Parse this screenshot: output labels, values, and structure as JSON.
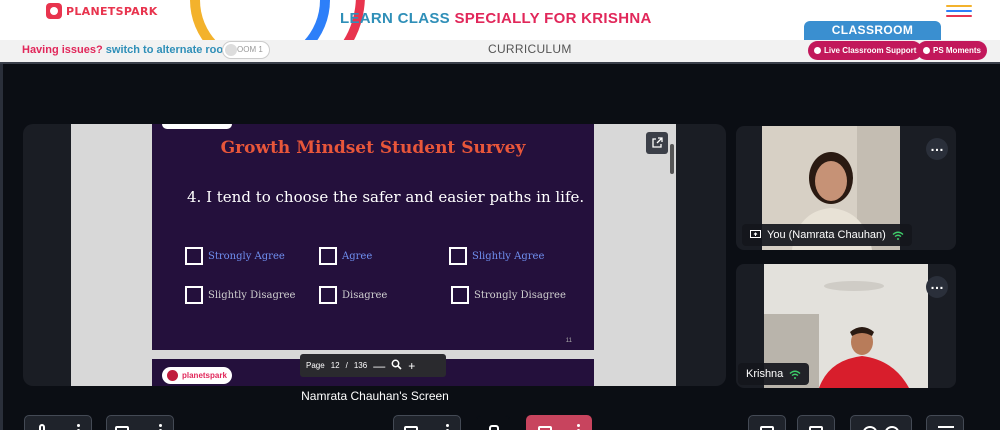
{
  "header": {
    "logo_text": "PLANETSPARK",
    "heading_prefix": "LEARN CLASS ",
    "heading_suffix": "SPECIALLY FOR KRISHNA",
    "classroom_tab": "CLASSROOM",
    "colors": {
      "brand_red": "#e1275a",
      "brand_blue": "#2f8fb8",
      "tab_blue": "#3a8fd0"
    }
  },
  "subbar": {
    "issues_text": "Having issues?",
    "switch_link": "switch to alternate room",
    "room_toggle_label": "OOM 1",
    "curriculum": "CURRICULUM",
    "live_support": "Live Classroom Support",
    "ps_moments": "PS Moments"
  },
  "slide": {
    "title": "Growth Mindset Student Survey",
    "question": "4. I tend to choose the safer and easier paths in life.",
    "options_row1": [
      "Strongly Agree",
      "Agree",
      "Slightly  Agree"
    ],
    "options_row2": [
      "Slightly Disagree",
      "Disagree",
      "Strongly Disagree"
    ],
    "page_number": "11",
    "next_slide_logo": "planetspark"
  },
  "pager": {
    "page_label": "Page",
    "current_page": "12",
    "separator": "/",
    "total_pages": "136",
    "zoom_out": "—",
    "zoom_in": "+"
  },
  "screen_caption": "Namrata Chauhan's Screen",
  "participants": [
    {
      "name": "You (Namrata Chauhan)",
      "icon": "screen-share-icon"
    },
    {
      "name": "Krishna"
    }
  ],
  "controls": {
    "icons": [
      "microphone-icon",
      "camera-icon",
      "screen-share-icon",
      "raise-hand-icon",
      "leave-icon",
      "chat-icon",
      "whiteboard-icon",
      "participants-icon",
      "menu-icon"
    ]
  }
}
